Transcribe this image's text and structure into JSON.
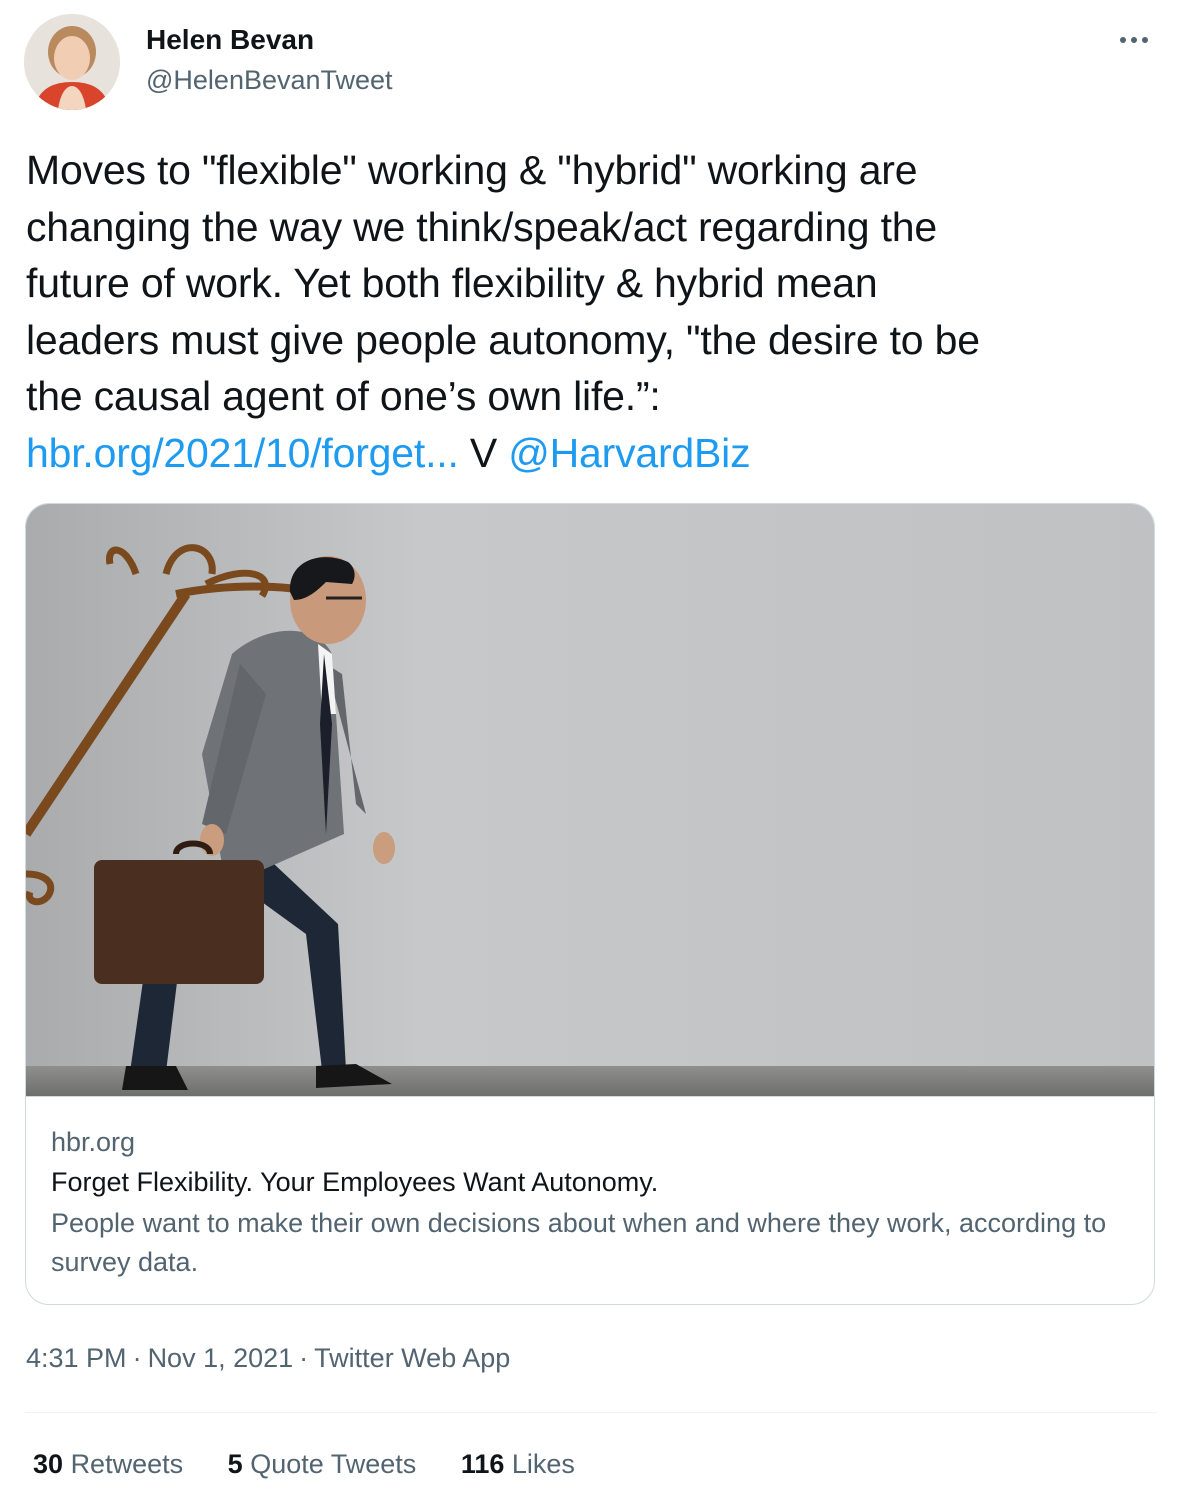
{
  "author": {
    "name": "Helen Bevan",
    "handle": "@HelenBevanTweet"
  },
  "more_icon": "more-horizontal-icon",
  "tweet": {
    "lines": [
      "Moves to \"flexible\" working & \"hybrid\" working are",
      "changing the way we think/speak/act regarding the",
      "future of work. Yet both flexibility & hybrid mean",
      "leaders must give people autonomy, \"the desire to be",
      "the causal agent of one’s own life.”:"
    ],
    "url_text": "hbr.org/2021/10/forget...",
    "via_text": " V ",
    "mention": "@HarvardBiz"
  },
  "card": {
    "domain": "hbr.org",
    "title": "Forget Flexibility. Your Employees Want Autonomy.",
    "description": "People want to make their own decisions about when and where they work, according to survey data."
  },
  "meta": {
    "time": "4:31 PM",
    "date": "Nov 1, 2021",
    "source": "Twitter Web App",
    "separator": "·"
  },
  "stats": {
    "retweets": {
      "count": "30",
      "label": "Retweets"
    },
    "quotes": {
      "count": "5",
      "label": "Quote Tweets"
    },
    "likes": {
      "count": "116",
      "label": "Likes"
    }
  },
  "colors": {
    "link": "#1d9bf0",
    "secondary_text": "#536471",
    "primary_text": "#0f1419",
    "border": "#cfd9de"
  }
}
